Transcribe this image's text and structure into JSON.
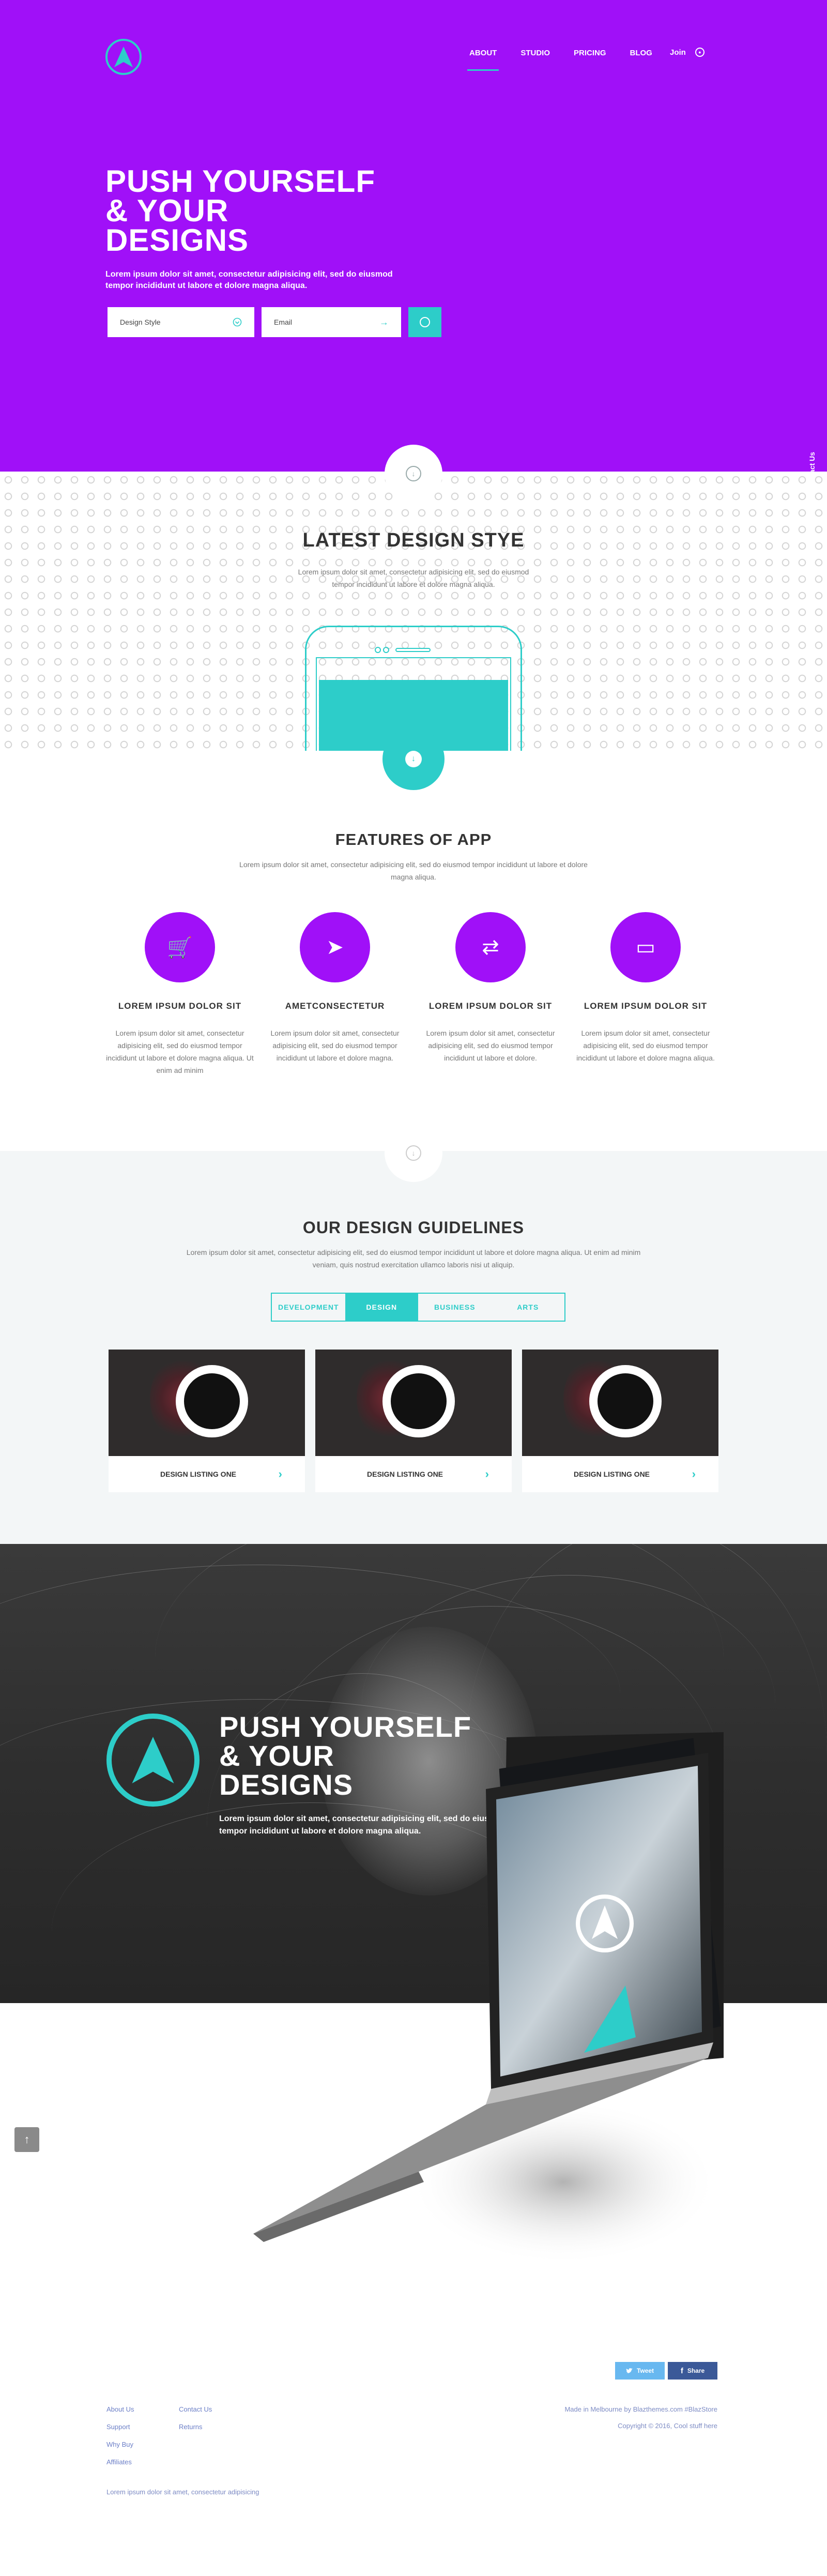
{
  "colors": {
    "brand": "#a010f8",
    "accent": "#2dcdc9",
    "dark": "#333333",
    "muted": "#777777"
  },
  "nav": {
    "items": [
      "ABOUT",
      "STUDIO",
      "PRICING",
      "BLOG"
    ],
    "active": "ABOUT",
    "join_label": "Join"
  },
  "hero": {
    "title_lines": [
      "PUSH YOURSELF",
      "& YOUR",
      "DESIGNS"
    ],
    "subtitle": "Lorem ipsum dolor sit amet, consectetur adipisicing elit, sed do eiusmod tempor incididunt ut labore et dolore magna aliqua.",
    "field1_value": "Design Style",
    "field2_value": "Email"
  },
  "contact_tab": "Contact Us",
  "latest": {
    "title": "LATEST DESIGN STYE",
    "text": "Lorem ipsum dolor sit amet, consectetur adipisicing elit, sed do eiusmod tempor incididunt ut labore et dolore magna aliqua."
  },
  "features": {
    "title": "FEATURES OF APP",
    "text": "Lorem ipsum dolor sit amet, consectetur adipisicing elit, sed do eiusmod tempor incididunt ut labore et dolore magna aliqua.",
    "items": [
      {
        "icon": "cart-icon",
        "glyph": "🛒",
        "title": "LOREM IPSUM DOLOR SIT",
        "text": "Lorem ipsum dolor sit amet, consectetur adipisicing elit, sed do eiusmod tempor incididunt ut labore et dolore magna aliqua. Ut enim ad minim"
      },
      {
        "icon": "send-icon",
        "glyph": "➤",
        "title": "AMETCONSECTETUR",
        "text": "Lorem ipsum dolor sit amet, consectetur adipisicing elit, sed do eiusmod tempor incididunt ut labore et dolore magna."
      },
      {
        "icon": "shuffle-icon",
        "glyph": "⇄",
        "title": "LOREM IPSUM DOLOR SIT",
        "text": "Lorem ipsum dolor sit amet, consectetur adipisicing elit, sed do eiusmod tempor incididunt ut labore et dolore."
      },
      {
        "icon": "browser-window-icon",
        "glyph": "▭",
        "title": "LOREM IPSUM DOLOR SIT",
        "text": "Lorem ipsum dolor sit amet, consectetur adipisicing elit, sed do eiusmod tempor incididunt ut labore et dolore magna aliqua."
      }
    ]
  },
  "guidelines": {
    "title": "OUR DESIGN GUIDELINES",
    "text": "Lorem ipsum dolor sit amet, consectetur adipisicing elit, sed do eiusmod tempor incididunt ut labore et dolore magna aliqua. Ut enim ad minim veniam, quis nostrud exercitation ullamco laboris nisi ut aliquip.",
    "tabs": [
      "DEVELOPMENT",
      "DESIGN",
      "BUSINESS",
      "ARTS"
    ],
    "active_tab": "DESIGN",
    "cards": [
      "DESIGN LISTING  ONE",
      "DESIGN LISTING  ONE",
      "DESIGN LISTING  ONE"
    ]
  },
  "promo": {
    "title_lines": [
      "PUSH YOURSELF",
      "& YOUR",
      "DESIGNS"
    ],
    "subtitle": "Lorem ipsum dolor sit amet, consectetur adipisicing elit, sed do eiusmod tempor incididunt ut labore et dolore magna aliqua."
  },
  "footer": {
    "tweet_label": "Tweet",
    "share_label": "Share",
    "col1": [
      "About Us",
      "Support",
      "Why Buy",
      "Affiliates"
    ],
    "col2": [
      "Contact Us",
      "Returns"
    ],
    "made_in": "Made in Melbourne by Blazthemes.com #BlazStore",
    "copyright": "Copyright © 2016, Cool stuff here",
    "bottom_text": "Lorem ipsum dolor sit amet, consectetur adipisicing"
  }
}
